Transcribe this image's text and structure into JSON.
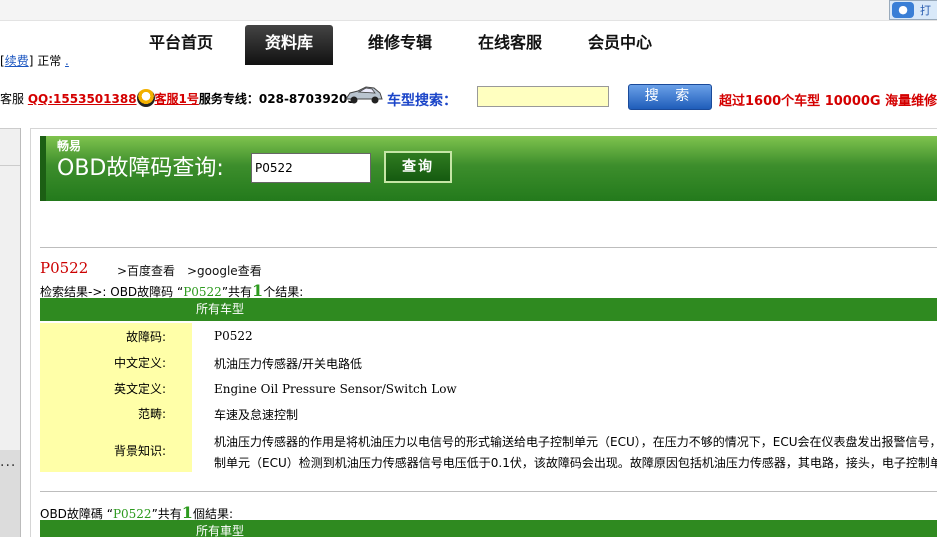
{
  "topbar": {
    "corner_icon": "baidu-paw-icon",
    "corner_text": "打"
  },
  "nav": {
    "items": [
      "平台首页",
      "资料库",
      "维修专辑",
      "在线客服",
      "会员中心"
    ],
    "active": "资料库"
  },
  "status": {
    "renew_link": "续费",
    "state": "正常",
    "dot_link": "."
  },
  "info": {
    "prefix": "客服",
    "qq": "QQ:1553501388",
    "agent": "客服1号",
    "hotline": "服务专线：028-87039205",
    "car_search_label": "车型搜索：",
    "car_search_value": "",
    "search_button": "搜 索",
    "promo": "超过1600个车型 10000G 海量维修"
  },
  "obd": {
    "brand": "畅易",
    "title": "OBD故障码查询:",
    "input_value": "P0522",
    "query_button": "查询"
  },
  "result": {
    "code": "P0522",
    "baidu_link": ">百度查看",
    "google_link": ">google查看",
    "summary_prefix": "检索结果->: OBD故障码 “",
    "summary_code": "P0522",
    "summary_mid": "”共有",
    "summary_count": "1",
    "summary_suffix": "个结果:",
    "table_head": "所有车型",
    "rows": [
      {
        "label": "故障码:",
        "value": "P0522"
      },
      {
        "label": "中文定义:",
        "value": "机油压力传感器/开关电路低"
      },
      {
        "label": "英文定义:",
        "value": "Engine Oil Pressure Sensor/Switch Low"
      },
      {
        "label": "范畴:",
        "value": "车速及怠速控制"
      },
      {
        "label": "背景知识:",
        "value_line1": "机油压力传感器的作用是将机油压力以电信号的形式输送给电子控制单元（ECU），在压力不够的情况下，ECU会在仪表盘发出报警信号，",
        "value_line2": "制单元（ECU）检测到机油压力传感器信号电压低于0.1伏，该故障码会出现。故障原因包括机油压力传感器，其电路，接头，电子控制单元"
      }
    ]
  },
  "result2": {
    "summary_prefix": "OBD故障碼 “",
    "summary_code": "P0522",
    "summary_mid": "”共有",
    "summary_count": "1",
    "summary_suffix": "個結果:",
    "table_head": "所有車型"
  }
}
